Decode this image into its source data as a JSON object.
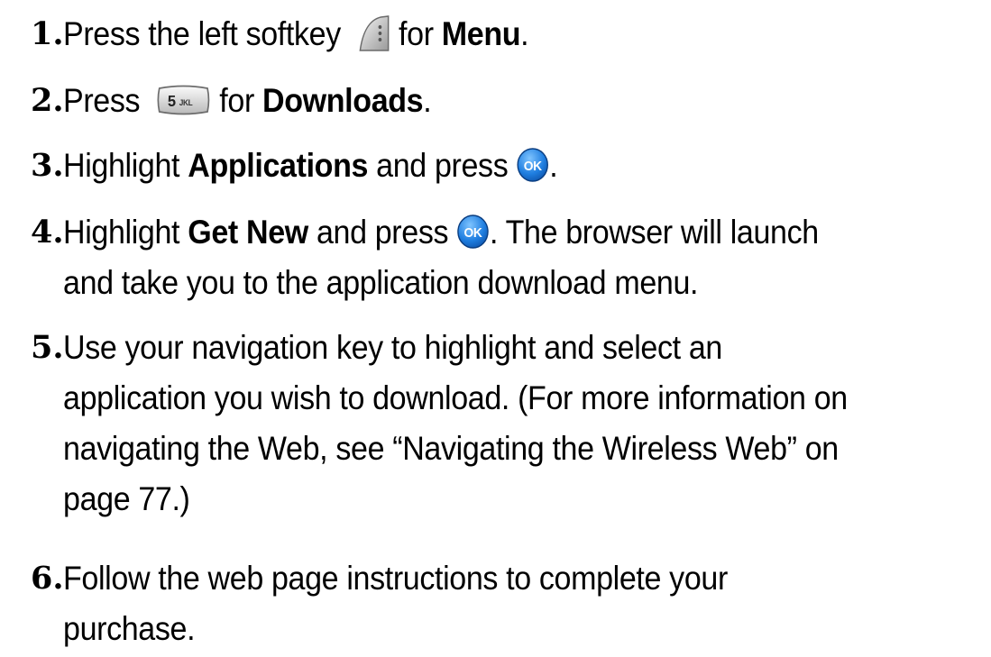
{
  "steps": [
    {
      "number": "1.",
      "pre": "Press the left softkey",
      "post": " for ",
      "bold": "Menu",
      "end": "."
    },
    {
      "number": "2.",
      "pre": "Press",
      "key_label": "5",
      "key_sub": "JKL",
      "post": " for ",
      "bold": "Downloads",
      "end": "."
    },
    {
      "number": "3.",
      "pre": "Highlight ",
      "bold": "Applications",
      "post": " and press ",
      "ok_label": "OK",
      "end": "."
    },
    {
      "number": "4.",
      "pre": "Highlight ",
      "bold": "Get New",
      "post": " and press ",
      "ok_label": "OK",
      "end": ". The browser will launch",
      "line2": "and take you to the application download menu."
    },
    {
      "number": "5.",
      "line1": "Use your navigation key to highlight and select an",
      "line2": "application you wish to download. (For more information on",
      "line3": "navigating the Web, see “Navigating the Wireless Web” on",
      "line4": "page 77.)"
    },
    {
      "number": "6.",
      "line1": "Follow the web page instructions to complete your",
      "line2": "purchase."
    }
  ],
  "icons": {
    "softkey": "left-softkey-icon",
    "key5": "key-5-jkl-icon",
    "ok": "ok-button-icon"
  }
}
